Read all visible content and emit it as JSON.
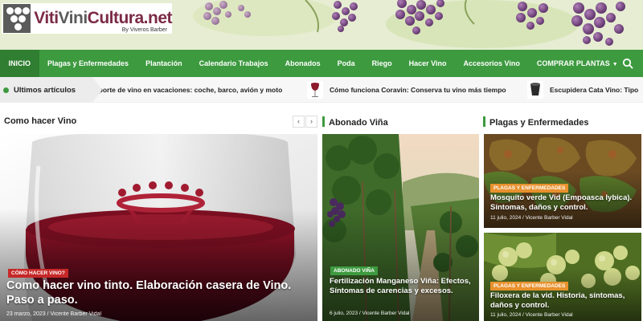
{
  "header": {
    "logo_part1": "Viti",
    "logo_part2": "Vini",
    "logo_part3": "Cultura.net",
    "logo_sub": "By Viveros Barber"
  },
  "nav": {
    "items": [
      {
        "label": "INICIO",
        "active": true
      },
      {
        "label": "Plagas y Enfermedades"
      },
      {
        "label": "Plantación"
      },
      {
        "label": "Calendario Trabajos"
      },
      {
        "label": "Abonados"
      },
      {
        "label": "Poda"
      },
      {
        "label": "Riego"
      },
      {
        "label": "Hacer Vino"
      },
      {
        "label": "Accesorios Vino"
      },
      {
        "label": "COMPRAR PLANTAS"
      }
    ],
    "search_icon": "search-icon",
    "dropdown_icon": "chevron-down-icon"
  },
  "ticker": {
    "label": "Ultimos artículos",
    "items": [
      {
        "title": "ansporte de vino en vacaciones: coche, barco, avión y moto"
      },
      {
        "title": "Cómo funciona Coravin: Conserva tu vino más tiempo"
      },
      {
        "title": "Escupidera Cata Vino: Tipo"
      }
    ]
  },
  "sections": {
    "como_hacer_vino": "Como hacer Vino",
    "abonado_vina": "Abonado Viña",
    "plagas": "Plagas y Enfermedades"
  },
  "cards": {
    "main": {
      "tag": "CÓMO HACER VINO?",
      "title": "Como hacer vino tinto. Elaboración casera de Vino. Paso a paso.",
      "date": "23 marzo, 2023",
      "author": "Vicente Barber Vidal"
    },
    "middle": {
      "tag": "ABONADO VIÑA",
      "title": "Fertilización Manganeso Viña: Efectos, Síntomas de carencias y excesos.",
      "date": "6 julio, 2023",
      "author": "Vicente Barber Vidal"
    },
    "right_top": {
      "tag": "PLAGAS Y ENFERMEDADES",
      "title": "Mosquito verde Vid (Empoasca lybica). Síntomas, daños y control.",
      "date": "11 julio, 2024",
      "author": "Vicente Barber Vidal"
    },
    "right_bottom": {
      "tag": "PLAGAS Y ENFERMEDADES",
      "title": "Filoxera de la vid. Historia, síntomas, daños y control.",
      "date": "11 julio, 2024",
      "author": "Vicente Barber Vidal"
    }
  },
  "colors": {
    "nav_green": "#3d9a3f",
    "tag_red": "#c62828",
    "tag_green": "#3d9a3f",
    "tag_orange": "#e8912d"
  },
  "meta_separator": " / "
}
